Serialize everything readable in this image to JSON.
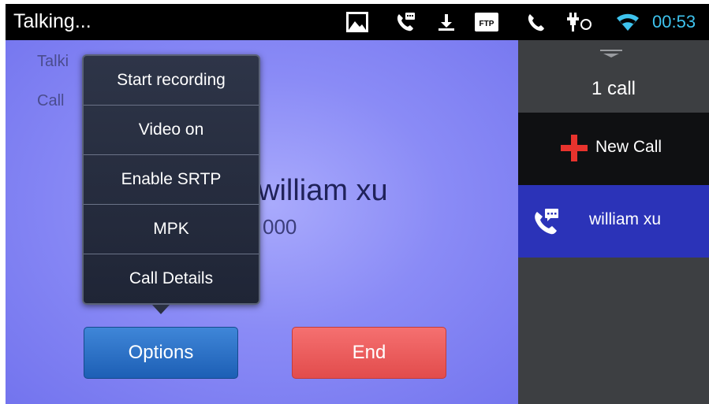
{
  "status_bar": {
    "title": "Talking...",
    "icons": [
      "image-icon",
      "voicemail-call-icon",
      "download-icon",
      "ftp-icon",
      "phone-icon",
      "usb-debug-icon",
      "wifi-icon"
    ],
    "ftp_label": "FTP",
    "clock": "00:53"
  },
  "call": {
    "status_line_1": "Talki",
    "status_line_2": "Call",
    "caller_name": "william xu",
    "caller_number": "000"
  },
  "options_menu": {
    "items": [
      "Start recording",
      "Video on",
      "Enable SRTP",
      "MPK",
      "Call Details"
    ]
  },
  "buttons": {
    "options": "Options",
    "end": "End"
  },
  "right_panel": {
    "call_count": "1 call",
    "new_call": "New Call",
    "active_call": "william xu"
  },
  "colors": {
    "accent_blue": "#2b33b8",
    "end_red": "#e24c4c",
    "plus_red": "#e8332d",
    "clock_cyan": "#3ec3ee"
  }
}
